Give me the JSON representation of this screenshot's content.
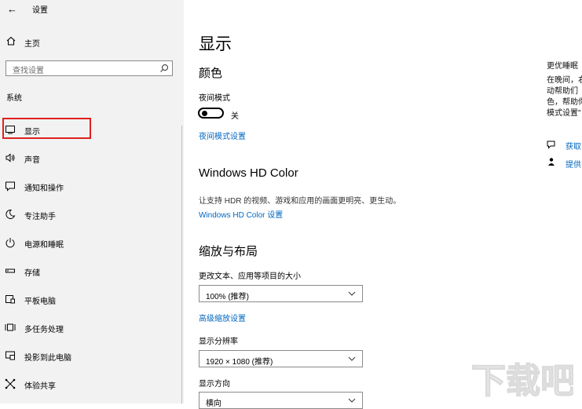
{
  "window": {
    "title": "设置",
    "back_glyph": "←"
  },
  "sidebar": {
    "home": "主页",
    "search_placeholder": "查找设置",
    "section": "系统",
    "items": [
      {
        "label": "显示",
        "icon": "monitor-icon"
      },
      {
        "label": "声音",
        "icon": "speaker-icon"
      },
      {
        "label": "通知和操作",
        "icon": "notification-icon"
      },
      {
        "label": "专注助手",
        "icon": "moon-icon"
      },
      {
        "label": "电源和睡眠",
        "icon": "power-icon"
      },
      {
        "label": "存储",
        "icon": "storage-icon"
      },
      {
        "label": "平板电脑",
        "icon": "tablet-icon"
      },
      {
        "label": "多任务处理",
        "icon": "multitask-icon"
      },
      {
        "label": "投影到此电脑",
        "icon": "project-icon"
      },
      {
        "label": "体验共享",
        "icon": "share-icon"
      }
    ]
  },
  "main": {
    "title": "显示",
    "color": {
      "heading": "颜色",
      "night_label": "夜间模式",
      "toggle_state": "关",
      "night_link": "夜间模式设置"
    },
    "hdr": {
      "heading": "Windows HD Color",
      "desc": "让支持 HDR 的视频、游戏和应用的画面更明亮、更生动。",
      "link": "Windows HD Color 设置"
    },
    "scale": {
      "heading": "缩放与布局",
      "size_label": "更改文本、应用等项目的大小",
      "size_value": "100% (推荐)",
      "advanced_link": "高级缩放设置",
      "res_label": "显示分辨率",
      "res_value": "1920 × 1080 (推荐)",
      "orient_label": "显示方向",
      "orient_value": "横向"
    }
  },
  "right": {
    "heading": "更优睡眠",
    "lines": [
      "在晚间，右",
      "动帮助们",
      "色，帮助你",
      "模式设置\""
    ],
    "link1": "获取",
    "link2": "提供"
  },
  "watermark": "下载吧"
}
